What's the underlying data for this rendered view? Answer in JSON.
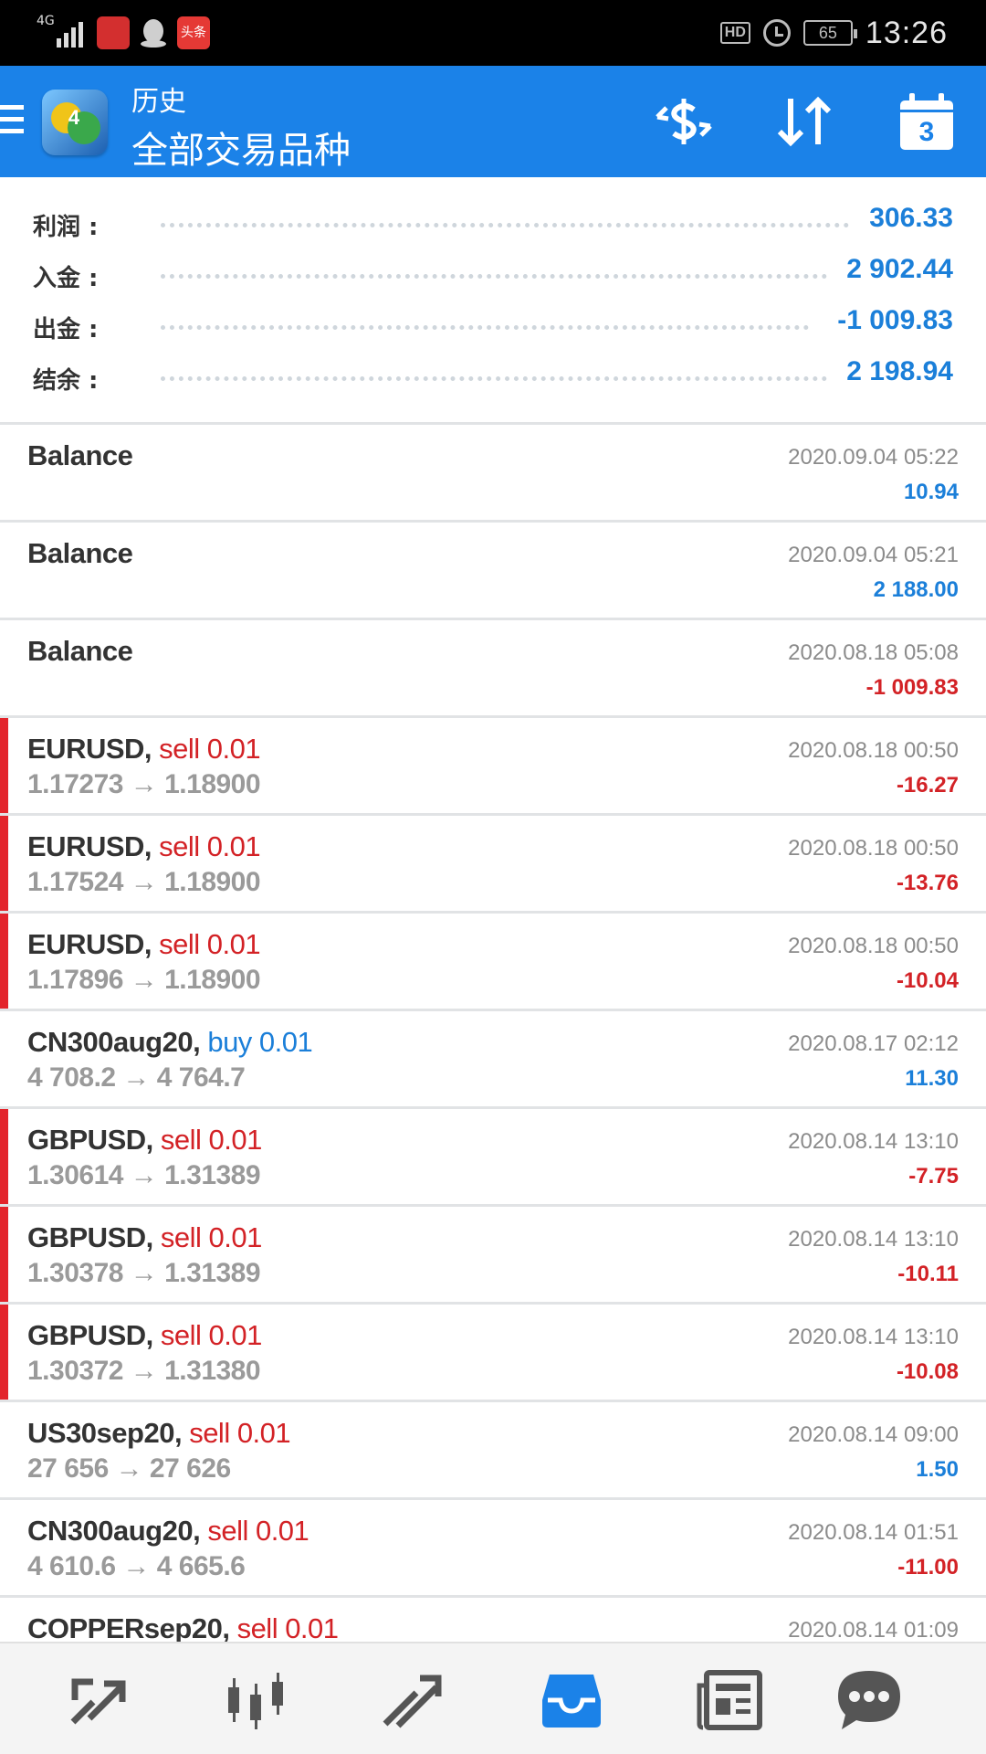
{
  "status_bar": {
    "network": "4G",
    "notification_app": "头条",
    "hd": "HD",
    "battery": "65",
    "time": "13:26"
  },
  "header": {
    "subtitle": "历史",
    "title": "全部交易品种",
    "calendar_day": "3",
    "background_color": "#1b82e8"
  },
  "summary": [
    {
      "label": "利润 :",
      "value": "306.33"
    },
    {
      "label": "入金 :",
      "value": "2 902.44"
    },
    {
      "label": "出金 :",
      "value": "-1 009.83"
    },
    {
      "label": "结余 :",
      "value": "2 198.94"
    }
  ],
  "deals": [
    {
      "title": "Balance",
      "time": "2020.09.04 05:22",
      "profit": "10.94",
      "profit_sign": "pos",
      "loss_marker": false
    },
    {
      "title": "Balance",
      "time": "2020.09.04 05:21",
      "profit": "2 188.00",
      "profit_sign": "pos",
      "loss_marker": false
    },
    {
      "title": "Balance",
      "time": "2020.08.18 05:08",
      "profit": "-1 009.83",
      "profit_sign": "neg",
      "loss_marker": false
    },
    {
      "symbol": "EURUSD",
      "side": "sell 0.01",
      "side_type": "sell",
      "prices": "1.17273 → 1.18900",
      "time": "2020.08.18 00:50",
      "profit": "-16.27",
      "profit_sign": "neg",
      "loss_marker": true
    },
    {
      "symbol": "EURUSD",
      "side": "sell 0.01",
      "side_type": "sell",
      "prices": "1.17524 → 1.18900",
      "time": "2020.08.18 00:50",
      "profit": "-13.76",
      "profit_sign": "neg",
      "loss_marker": true
    },
    {
      "symbol": "EURUSD",
      "side": "sell 0.01",
      "side_type": "sell",
      "prices": "1.17896 → 1.18900",
      "time": "2020.08.18 00:50",
      "profit": "-10.04",
      "profit_sign": "neg",
      "loss_marker": true
    },
    {
      "symbol": "CN300aug20",
      "side": "buy 0.01",
      "side_type": "buy",
      "prices": "4 708.2 → 4 764.7",
      "time": "2020.08.17 02:12",
      "profit": "11.30",
      "profit_sign": "pos",
      "loss_marker": false
    },
    {
      "symbol": "GBPUSD",
      "side": "sell 0.01",
      "side_type": "sell",
      "prices": "1.30614 → 1.31389",
      "time": "2020.08.14 13:10",
      "profit": "-7.75",
      "profit_sign": "neg",
      "loss_marker": true
    },
    {
      "symbol": "GBPUSD",
      "side": "sell 0.01",
      "side_type": "sell",
      "prices": "1.30378 → 1.31389",
      "time": "2020.08.14 13:10",
      "profit": "-10.11",
      "profit_sign": "neg",
      "loss_marker": true
    },
    {
      "symbol": "GBPUSD",
      "side": "sell 0.01",
      "side_type": "sell",
      "prices": "1.30372 → 1.31380",
      "time": "2020.08.14 13:10",
      "profit": "-10.08",
      "profit_sign": "neg",
      "loss_marker": true
    },
    {
      "symbol": "US30sep20",
      "side": "sell 0.01",
      "side_type": "sell",
      "prices": "27 656 → 27 626",
      "time": "2020.08.14 09:00",
      "profit": "1.50",
      "profit_sign": "pos",
      "loss_marker": false
    },
    {
      "symbol": "CN300aug20",
      "side": "sell 0.01",
      "side_type": "sell",
      "prices": "4 610.6 → 4 665.6",
      "time": "2020.08.14 01:51",
      "profit": "-11.00",
      "profit_sign": "neg",
      "loss_marker": false
    },
    {
      "symbol": "COPPERsep20",
      "side": "sell 0.01",
      "side_type": "sell",
      "prices": "",
      "time": "2020.08.14 01:09",
      "profit": "",
      "profit_sign": "neg",
      "loss_marker": false
    }
  ],
  "bottom_nav": [
    {
      "icon": "quotes-icon",
      "active": false
    },
    {
      "icon": "chart-icon",
      "active": false
    },
    {
      "icon": "trade-icon",
      "active": false
    },
    {
      "icon": "history-icon",
      "active": true
    },
    {
      "icon": "news-icon",
      "active": false
    },
    {
      "icon": "chat-icon",
      "active": false
    }
  ],
  "colors": {
    "accent": "#1b82e8",
    "profit_positive": "#1b7fd9",
    "profit_negative": "#d32226",
    "loss_marker": "#e3242b",
    "nav_active": "#1b82e8",
    "nav_inactive": "#555555"
  }
}
